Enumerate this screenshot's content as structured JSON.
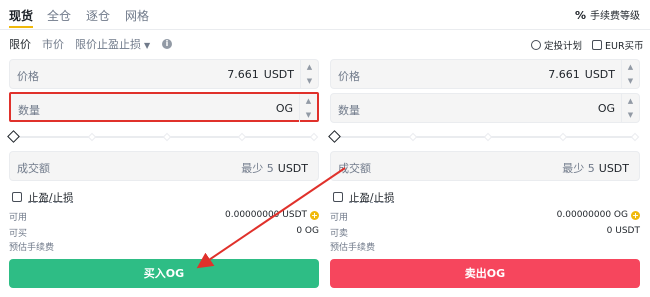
{
  "tabs": {
    "items": [
      "现货",
      "全仓",
      "逐仓",
      "网格"
    ],
    "fee_level_label": "手续费等级",
    "fee_icon": "%"
  },
  "order_types": {
    "limit": "限价",
    "market": "市价",
    "stop_limit": "限价止盈止损",
    "info_icon": "i",
    "auto_invest": "定投计划",
    "buy_eur": "EUR买币"
  },
  "buy": {
    "price_label": "价格",
    "price_value": "7.661",
    "price_unit": "USDT",
    "amount_label": "数量",
    "amount_unit": "OG",
    "total_label": "成交额",
    "total_hint": "最少 5",
    "total_unit": "USDT",
    "tpsl_label": "止盈/止损",
    "available_label": "可用",
    "available_value": "0.00000000 USDT",
    "max_label": "可买",
    "max_value": "0 OG",
    "fee_label": "预估手续费",
    "button_label": "买入OG"
  },
  "sell": {
    "price_label": "价格",
    "price_value": "7.661",
    "price_unit": "USDT",
    "amount_label": "数量",
    "amount_unit": "OG",
    "total_label": "成交额",
    "total_hint": "最少 5",
    "total_unit": "USDT",
    "tpsl_label": "止盈/止损",
    "available_label": "可用",
    "available_value": "0.00000000 OG",
    "max_label": "可卖",
    "max_value": "0 USDT",
    "fee_label": "预估手续费",
    "button_label": "卖出OG"
  },
  "slider_percent": 0,
  "colors": {
    "accent": "#f0b90b",
    "buy": "#2ebd85",
    "sell": "#f6465d",
    "annotation": "#e0312b"
  }
}
